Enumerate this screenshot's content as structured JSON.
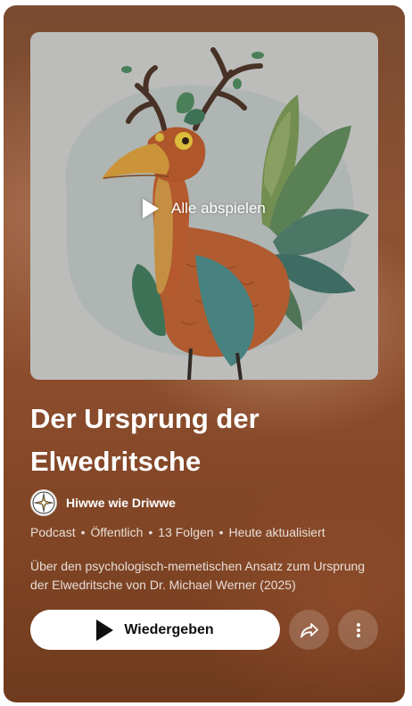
{
  "playlist": {
    "play_all_label": "Alle abspielen",
    "title": "Der Ursprung der Elwedritsche",
    "channel": {
      "name": "Hiwwe wie Driwwe"
    },
    "meta": [
      "Podcast",
      "Öffentlich",
      "13 Folgen",
      "Heute aktualisiert"
    ],
    "description": "Über den psychologisch-memetischen Ansatz zum Ursprung der Elwedritsche von Dr. Michael Werner (2025)",
    "play_button_label": "Wiedergeben"
  },
  "icons": {
    "play_all": "play-icon",
    "play_button": "play-icon",
    "share": "share-arrow-icon",
    "more": "more-vertical-icon",
    "avatar": "compass-rose-logo"
  },
  "colors": {
    "background": "#8a4c2c",
    "text_primary": "#ffffff",
    "button_bg": "#ffffff",
    "button_text": "#0f0f0f"
  }
}
